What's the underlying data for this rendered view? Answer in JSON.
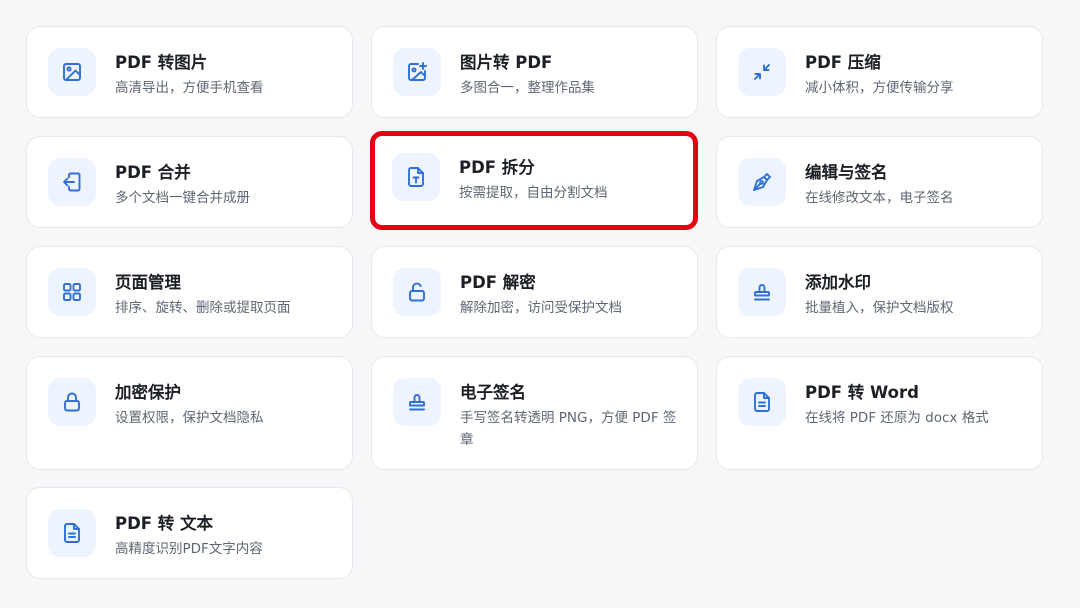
{
  "colors": {
    "icon": "#2f6fd6",
    "icon_bg": "#eef4fd",
    "highlight_border": "#e60012",
    "title": "#1c1f26",
    "description": "#5f6673"
  },
  "tools": [
    {
      "title": "PDF 转图片",
      "description": "高清导出，方便手机查看",
      "icon": "image-icon"
    },
    {
      "title": "图片转 PDF",
      "description": "多图合一，整理作品集",
      "icon": "image-add-icon"
    },
    {
      "title": "PDF 压缩",
      "description": "减小体积，方便传输分享",
      "icon": "compress-arrows-icon"
    },
    {
      "title": "PDF 合并",
      "description": "多个文档一键合并成册",
      "icon": "merge-file-icon"
    },
    {
      "title": "PDF 拆分",
      "description": "按需提取，自由分割文档",
      "icon": "file-text-icon",
      "selected": true
    },
    {
      "title": "编辑与签名",
      "description": "在线修改文本，电子签名",
      "icon": "pen-nib-icon"
    },
    {
      "title": "页面管理",
      "description": "排序、旋转、删除或提取页面",
      "icon": "grid-icon"
    },
    {
      "title": "PDF 解密",
      "description": "解除加密，访问受保护文档",
      "icon": "unlock-icon"
    },
    {
      "title": "添加水印",
      "description": "批量植入，保护文档版权",
      "icon": "stamp-icon"
    },
    {
      "title": "加密保护",
      "description": "设置权限，保护文档隐私",
      "icon": "lock-icon"
    },
    {
      "title": "电子签名",
      "description": "手写签名转透明 PNG，方便 PDF 签章",
      "icon": "stamp-icon"
    },
    {
      "title": "PDF 转 Word",
      "description": "在线将 PDF 还原为 docx 格式",
      "icon": "document-icon"
    },
    {
      "title": "PDF 转 文本",
      "description": "高精度识别PDF文字内容",
      "icon": "document-icon"
    }
  ]
}
